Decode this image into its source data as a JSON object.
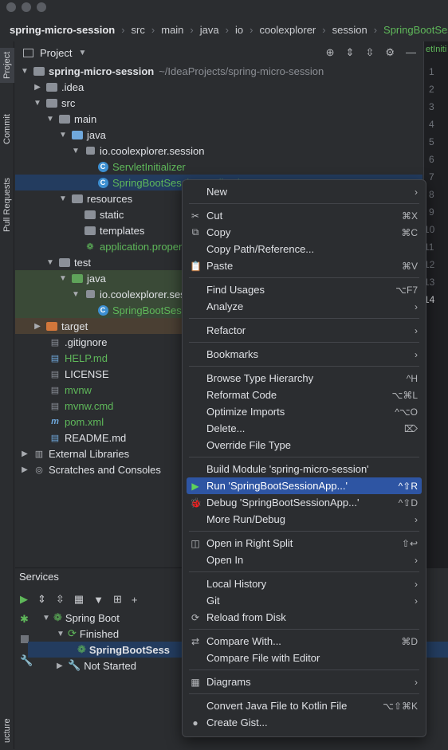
{
  "breadcrumb": [
    "spring-micro-session",
    "src",
    "main",
    "java",
    "io",
    "coolexplorer",
    "session",
    "SpringBootSession"
  ],
  "left_strip": {
    "project": "Project",
    "commit": "Commit",
    "pull_requests": "Pull Requests",
    "structure": "ucture"
  },
  "project_panel": {
    "title": "Project"
  },
  "tree": [
    {
      "label": "spring-micro-session",
      "suffix": "~/IdeaProjects/spring-micro-session"
    },
    {
      "label": ".idea"
    },
    {
      "label": "src"
    },
    {
      "label": "main"
    },
    {
      "label": "java"
    },
    {
      "label": "io.coolexplorer.session"
    },
    {
      "label": "ServletInitializer"
    },
    {
      "label": "SpringBootSessionApplication"
    },
    {
      "label": "resources"
    },
    {
      "label": "static"
    },
    {
      "label": "templates"
    },
    {
      "label": "application.properties"
    },
    {
      "label": "test"
    },
    {
      "label": "java"
    },
    {
      "label": "io.coolexplorer.session"
    },
    {
      "label": "SpringBootSessionApplicationTests"
    },
    {
      "label": "target"
    },
    {
      "label": ".gitignore"
    },
    {
      "label": "HELP.md"
    },
    {
      "label": "LICENSE"
    },
    {
      "label": "mvnw"
    },
    {
      "label": "mvnw.cmd"
    },
    {
      "label": "pom.xml"
    },
    {
      "label": "README.md"
    },
    {
      "label": "External Libraries"
    },
    {
      "label": "Scratches and Consoles"
    }
  ],
  "editor": {
    "tab": "etIniti",
    "line_numbers": [
      "1",
      "2",
      "3",
      "4",
      "5",
      "6",
      "7",
      "8",
      "9",
      "10",
      "11",
      "12",
      "13",
      "14"
    ]
  },
  "services": {
    "title": "Services",
    "tree": [
      "Spring Boot",
      "Finished",
      "SpringBootSess",
      "Not Started"
    ]
  },
  "menu": [
    {
      "label": "New",
      "submenu": true
    },
    {
      "sep": true
    },
    {
      "label": "Cut",
      "shortcut": "⌘X",
      "icon": "✂"
    },
    {
      "label": "Copy",
      "shortcut": "⌘C",
      "icon": "⧉"
    },
    {
      "label": "Copy Path/Reference..."
    },
    {
      "label": "Paste",
      "shortcut": "⌘V",
      "icon": "📋"
    },
    {
      "sep": true
    },
    {
      "label": "Find Usages",
      "shortcut": "⌥F7"
    },
    {
      "label": "Analyze",
      "submenu": true
    },
    {
      "sep": true
    },
    {
      "label": "Refactor",
      "submenu": true
    },
    {
      "sep": true
    },
    {
      "label": "Bookmarks",
      "submenu": true
    },
    {
      "sep": true
    },
    {
      "label": "Browse Type Hierarchy",
      "shortcut": "^H"
    },
    {
      "label": "Reformat Code",
      "shortcut": "⌥⌘L"
    },
    {
      "label": "Optimize Imports",
      "shortcut": "^⌥O"
    },
    {
      "label": "Delete...",
      "shortcut": "⌦"
    },
    {
      "label": "Override File Type"
    },
    {
      "sep": true
    },
    {
      "label": "Build Module 'spring-micro-session'"
    },
    {
      "label": "Run 'SpringBootSessionApp...'",
      "shortcut": "^⇧R",
      "icon": "▶",
      "highlight": true
    },
    {
      "label": "Debug 'SpringBootSessionApp...'",
      "shortcut": "^⇧D",
      "icon": "🐞"
    },
    {
      "label": "More Run/Debug",
      "submenu": true
    },
    {
      "sep": true
    },
    {
      "label": "Open in Right Split",
      "shortcut": "⇧↩",
      "icon": "◫"
    },
    {
      "label": "Open In",
      "submenu": true
    },
    {
      "sep": true
    },
    {
      "label": "Local History",
      "submenu": true
    },
    {
      "label": "Git",
      "submenu": true
    },
    {
      "label": "Reload from Disk",
      "icon": "⟳"
    },
    {
      "sep": true
    },
    {
      "label": "Compare With...",
      "shortcut": "⌘D",
      "icon": "⇄"
    },
    {
      "label": "Compare File with Editor"
    },
    {
      "sep": true
    },
    {
      "label": "Diagrams",
      "submenu": true,
      "icon": "▦"
    },
    {
      "sep": true
    },
    {
      "label": "Convert Java File to Kotlin File",
      "shortcut": "⌥⇧⌘K"
    },
    {
      "label": "Create Gist...",
      "icon": "●"
    }
  ]
}
